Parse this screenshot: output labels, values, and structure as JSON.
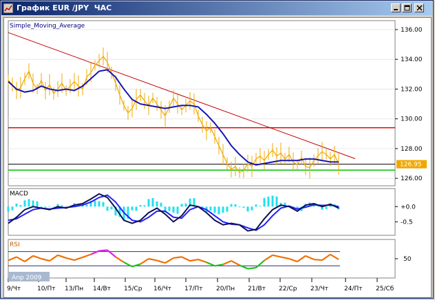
{
  "window": {
    "title": "График EUR /JPY  ЧАС",
    "buttons": [
      "minimize",
      "restore",
      "close"
    ]
  },
  "colors": {
    "price": "#f0a800",
    "sma": "#1515b0",
    "trendline": "#c00000",
    "resistance": "#e00000",
    "support": "#00c000",
    "current_line": "#000000",
    "price_badge": "#f0a800",
    "macd_main": "#101050",
    "macd_signal": "#2020ff",
    "macd_hist": "#20e0f0",
    "rsi": "#f07000",
    "rsi_overbought": "#e020e0",
    "rsi_oversold": "#20c020",
    "period_badge": "#a8b8d0"
  },
  "chart_data": [
    {
      "type": "line",
      "panel": "price",
      "title": "Simple_Moving_Average",
      "ylim": [
        125.5,
        136.6
      ],
      "y_ticks": [
        "136.00",
        "134.00",
        "132.00",
        "130.00",
        "128.00",
        "126.00"
      ],
      "current_price": "126.95",
      "current_value": 126.95,
      "horizontal_levels": [
        {
          "kind": "resistance",
          "value": 129.4
        },
        {
          "kind": "current",
          "value": 126.95
        },
        {
          "kind": "support",
          "value": 126.55
        }
      ],
      "trendline": {
        "from": [
          "9/Чт",
          135.8
        ],
        "to": [
          "23/Чт",
          127.6
        ]
      },
      "series": [
        {
          "role": "price",
          "x": [
            0,
            1,
            2,
            3,
            4,
            5,
            6,
            7,
            8,
            9,
            10,
            11,
            12,
            13,
            14,
            15,
            16,
            17,
            18,
            19,
            20,
            21,
            22,
            23,
            24,
            25,
            26,
            27,
            28,
            29,
            30,
            31,
            32,
            33,
            34,
            35,
            36,
            37,
            38,
            39,
            40,
            41,
            42,
            43,
            44,
            45,
            46,
            47,
            48,
            49,
            50,
            51,
            52,
            53,
            54,
            55,
            56,
            57,
            58,
            59,
            60,
            61,
            62,
            63,
            64,
            65,
            66,
            67,
            68,
            69,
            70,
            71,
            72,
            73,
            74,
            75,
            76,
            77,
            78,
            79,
            80
          ],
          "values": [
            132.6,
            132.3,
            131.9,
            132.1,
            132.7,
            133.2,
            132.4,
            132.0,
            132.6,
            131.9,
            132.3,
            131.7,
            132.0,
            132.4,
            131.9,
            132.2,
            132.5,
            132.2,
            132.0,
            132.8,
            133.1,
            133.6,
            133.9,
            134.2,
            133.8,
            133.1,
            132.4,
            131.6,
            130.9,
            130.4,
            130.7,
            131.3,
            131.6,
            131.2,
            130.9,
            131.4,
            131.0,
            130.6,
            130.2,
            130.8,
            131.4,
            131.0,
            130.6,
            130.9,
            131.2,
            131.0,
            130.2,
            129.6,
            129.2,
            129.4,
            128.8,
            128.2,
            127.6,
            127.0,
            126.6,
            126.8,
            126.4,
            126.5,
            127.0,
            126.8,
            127.3,
            127.5,
            127.2,
            127.6,
            127.9,
            127.5,
            127.7,
            127.3,
            127.6,
            127.1,
            126.9,
            127.4,
            126.8,
            126.7,
            127.2,
            127.5,
            127.8,
            127.6,
            127.3,
            127.6,
            126.95
          ]
        },
        {
          "role": "sma",
          "x": [
            0,
            2,
            4,
            6,
            8,
            10,
            12,
            14,
            16,
            18,
            20,
            22,
            24,
            26,
            28,
            30,
            32,
            34,
            36,
            38,
            40,
            42,
            44,
            46,
            48,
            50,
            52,
            54,
            56,
            58,
            60,
            62,
            64,
            66,
            68,
            70,
            72,
            74,
            76,
            78,
            80
          ],
          "values": [
            132.5,
            132.0,
            131.8,
            131.9,
            132.2,
            132.0,
            131.9,
            132.0,
            131.9,
            132.2,
            132.7,
            133.2,
            133.3,
            132.8,
            132.0,
            131.3,
            131.0,
            130.9,
            130.8,
            130.7,
            130.8,
            130.9,
            130.9,
            130.8,
            130.3,
            129.7,
            129.0,
            128.2,
            127.6,
            127.1,
            126.9,
            127.0,
            127.1,
            127.2,
            127.2,
            127.2,
            127.3,
            127.3,
            127.2,
            127.1,
            127.1
          ]
        }
      ]
    },
    {
      "type": "line",
      "panel": "macd",
      "title": "MACD",
      "ylim": [
        -0.9,
        0.55
      ],
      "y_ticks": [
        "+0.0",
        "-0.5"
      ],
      "series": [
        {
          "role": "main",
          "x": [
            0,
            2,
            4,
            6,
            8,
            10,
            12,
            14,
            16,
            18,
            20,
            22,
            24,
            26,
            28,
            30,
            32,
            34,
            36,
            38,
            40,
            42,
            44,
            46,
            48,
            50,
            52,
            54,
            56,
            58,
            60,
            62,
            64,
            66,
            68,
            70,
            72,
            74,
            76,
            78,
            80
          ],
          "values": [
            -0.55,
            -0.35,
            -0.1,
            0.0,
            -0.05,
            -0.1,
            0.0,
            -0.05,
            0.05,
            0.1,
            0.25,
            0.42,
            0.3,
            -0.05,
            -0.45,
            -0.55,
            -0.45,
            -0.2,
            -0.05,
            -0.25,
            -0.5,
            -0.3,
            0.05,
            0.0,
            -0.2,
            -0.45,
            -0.6,
            -0.55,
            -0.6,
            -0.8,
            -0.75,
            -0.4,
            -0.1,
            0.05,
            0.0,
            -0.15,
            0.05,
            0.1,
            0.0,
            0.08,
            -0.05
          ]
        },
        {
          "role": "signal",
          "x": [
            0,
            2,
            4,
            6,
            8,
            10,
            12,
            14,
            16,
            18,
            20,
            22,
            24,
            26,
            28,
            30,
            32,
            34,
            36,
            38,
            40,
            42,
            44,
            46,
            48,
            50,
            52,
            54,
            56,
            58,
            60,
            62,
            64,
            66,
            68,
            70,
            72,
            74,
            76,
            78,
            80
          ],
          "values": [
            -0.45,
            -0.4,
            -0.25,
            -0.1,
            -0.05,
            -0.08,
            -0.05,
            -0.03,
            0.0,
            0.05,
            0.15,
            0.3,
            0.38,
            0.15,
            -0.2,
            -0.45,
            -0.5,
            -0.35,
            -0.15,
            -0.15,
            -0.35,
            -0.38,
            -0.1,
            0.0,
            -0.1,
            -0.3,
            -0.5,
            -0.58,
            -0.6,
            -0.7,
            -0.78,
            -0.6,
            -0.3,
            -0.05,
            0.02,
            -0.08,
            -0.02,
            0.06,
            0.04,
            0.05,
            0.0
          ]
        }
      ]
    },
    {
      "type": "line",
      "panel": "rsi",
      "title": "RSI",
      "ylim": [
        0,
        100
      ],
      "y_ticks": [
        "50"
      ],
      "levels": [
        70,
        30
      ],
      "series": [
        {
          "role": "rsi",
          "x": [
            0,
            2,
            4,
            6,
            8,
            10,
            12,
            14,
            16,
            18,
            20,
            22,
            24,
            26,
            28,
            30,
            32,
            34,
            36,
            38,
            40,
            42,
            44,
            46,
            48,
            50,
            52,
            54,
            56,
            58,
            60,
            62,
            64,
            66,
            68,
            70,
            72,
            74,
            76,
            78,
            80
          ],
          "values": [
            45,
            55,
            42,
            58,
            50,
            44,
            60,
            52,
            46,
            54,
            62,
            72,
            74,
            55,
            40,
            28,
            35,
            50,
            45,
            38,
            52,
            55,
            44,
            48,
            40,
            30,
            34,
            44,
            32,
            22,
            25,
            45,
            60,
            55,
            50,
            42,
            58,
            48,
            46,
            62,
            48
          ]
        }
      ]
    }
  ],
  "x_axis": {
    "labels": [
      "9/Чт",
      "10/Пт",
      "13/Пн",
      "14/Вт",
      "15/Ср",
      "16/Чт",
      "17/Пт",
      "20/Пн",
      "21/Вт",
      "22/Ср",
      "23/Чт",
      "24/Пт",
      "25/Сб"
    ],
    "period_label": "Апр 2009"
  }
}
